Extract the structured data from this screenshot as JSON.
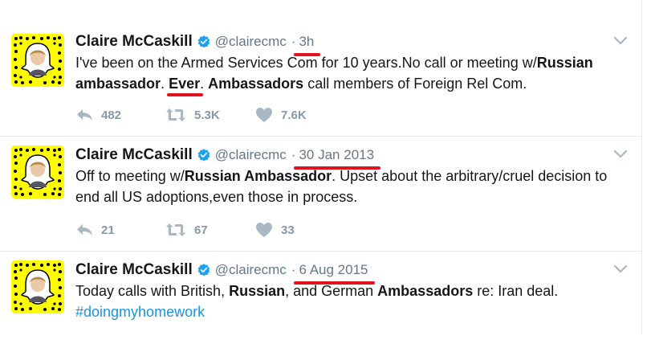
{
  "tweets": [
    {
      "name": "Claire McCaskill",
      "handle": "@clairecmc",
      "separator": "·",
      "time": "3h",
      "text_parts": {
        "p1": "I've been on the Armed Services Com for 10 years.No call or meeting w/",
        "p2": "Russian",
        "p3": "ambassador",
        "p4": ". ",
        "p5": "Ever",
        "p6": ". ",
        "p7": "Ambassadors",
        "p8": " call members of Foreign Rel Com."
      },
      "reply_count": "482",
      "retweet_count": "5.3K",
      "like_count": "7.6K"
    },
    {
      "name": "Claire McCaskill",
      "handle": "@clairecmc",
      "separator": "·",
      "time": "30 Jan 2013",
      "text_parts": {
        "p1": "Off to meeting w/",
        "p2": "Russian Ambassador",
        "p3": ". Upset about the arbitrary/cruel decision to end all US adoptions,even those in process."
      },
      "reply_count": "21",
      "retweet_count": "67",
      "like_count": "33"
    },
    {
      "name": "Claire McCaskill",
      "handle": "@clairecmc",
      "separator": "·",
      "time": "6 Aug 2015",
      "text_parts": {
        "p1": "Today calls with British, ",
        "p2": "Russian",
        "p3": ", and German ",
        "p4": "Ambassadors",
        "p5": " re: Iran deal.",
        "hashtag": "#doingmyhomework"
      }
    }
  ],
  "colors": {
    "accent": "#1b95e0",
    "annotation": "#e0141e",
    "avatar_bg": "#fffc00",
    "muted": "#8899a6"
  },
  "icons": [
    "snapcode-avatar",
    "verified-badge-icon",
    "caret-down-icon",
    "reply-icon",
    "retweet-icon",
    "like-icon"
  ]
}
